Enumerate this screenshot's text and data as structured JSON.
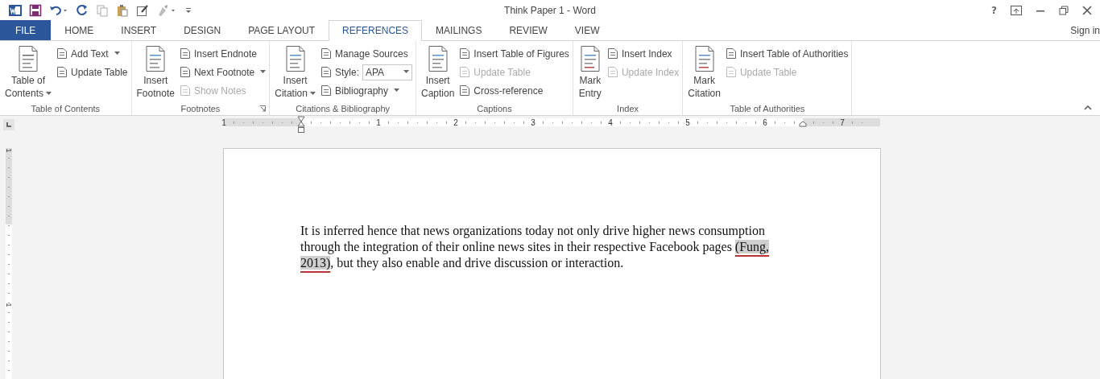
{
  "window": {
    "title": "Think Paper 1 - Word",
    "help": "?"
  },
  "tabs": [
    {
      "label": "FILE",
      "kind": "file",
      "selected": false
    },
    {
      "label": "HOME",
      "kind": "tab",
      "selected": false
    },
    {
      "label": "INSERT",
      "kind": "tab",
      "selected": false
    },
    {
      "label": "DESIGN",
      "kind": "tab",
      "selected": false
    },
    {
      "label": "PAGE LAYOUT",
      "kind": "tab",
      "selected": false
    },
    {
      "label": "REFERENCES",
      "kind": "tab",
      "selected": true
    },
    {
      "label": "MAILINGS",
      "kind": "tab",
      "selected": false
    },
    {
      "label": "REVIEW",
      "kind": "tab",
      "selected": false
    },
    {
      "label": "VIEW",
      "kind": "tab",
      "selected": false
    }
  ],
  "sign_in": "Sign in",
  "ribbon": [
    {
      "label": "Table of Contents",
      "launcher": false,
      "columns": [
        {
          "kind": "large",
          "lines": [
            "Table of",
            "Contents"
          ],
          "dropdown": true,
          "disabled": false
        },
        {
          "kind": "stack",
          "items": [
            {
              "label": "Add Text",
              "dropdown": true,
              "disabled": false
            },
            {
              "label": "Update Table",
              "dropdown": false,
              "disabled": false
            }
          ]
        }
      ]
    },
    {
      "label": "Footnotes",
      "launcher": true,
      "columns": [
        {
          "kind": "large",
          "lines": [
            "Insert",
            "Footnote"
          ],
          "dropdown": false,
          "disabled": false
        },
        {
          "kind": "stack",
          "items": [
            {
              "label": "Insert Endnote",
              "dropdown": false,
              "disabled": false
            },
            {
              "label": "Next Footnote",
              "dropdown": true,
              "disabled": false
            },
            {
              "label": "Show Notes",
              "dropdown": false,
              "disabled": true
            }
          ]
        }
      ]
    },
    {
      "label": "Citations & Bibliography",
      "launcher": false,
      "columns": [
        {
          "kind": "large",
          "lines": [
            "Insert",
            "Citation"
          ],
          "dropdown": true,
          "disabled": false
        },
        {
          "kind": "stack",
          "items": [
            {
              "label": "Manage Sources",
              "dropdown": false,
              "disabled": false
            },
            {
              "label": "Style:",
              "dropdown": false,
              "disabled": false,
              "combo": "APA"
            },
            {
              "label": "Bibliography",
              "dropdown": true,
              "disabled": false
            }
          ]
        }
      ]
    },
    {
      "label": "Captions",
      "launcher": false,
      "columns": [
        {
          "kind": "large",
          "lines": [
            "Insert",
            "Caption"
          ],
          "dropdown": false,
          "disabled": false
        },
        {
          "kind": "stack",
          "items": [
            {
              "label": "Insert Table of Figures",
              "dropdown": false,
              "disabled": false
            },
            {
              "label": "Update Table",
              "dropdown": false,
              "disabled": true
            },
            {
              "label": "Cross-reference",
              "dropdown": false,
              "disabled": false
            }
          ]
        }
      ]
    },
    {
      "label": "Index",
      "launcher": false,
      "columns": [
        {
          "kind": "large",
          "lines": [
            "Mark",
            "Entry"
          ],
          "dropdown": false,
          "disabled": false
        },
        {
          "kind": "stack",
          "items": [
            {
              "label": "Insert Index",
              "dropdown": false,
              "disabled": false
            },
            {
              "label": "Update Index",
              "dropdown": false,
              "disabled": true
            }
          ]
        }
      ]
    },
    {
      "label": "Table of Authorities",
      "launcher": false,
      "columns": [
        {
          "kind": "large",
          "lines": [
            "Mark",
            "Citation"
          ],
          "dropdown": false,
          "disabled": false
        },
        {
          "kind": "stack",
          "items": [
            {
              "label": "Insert Table of Authorities",
              "dropdown": false,
              "disabled": false
            },
            {
              "label": "Update Table",
              "dropdown": false,
              "disabled": true
            }
          ]
        }
      ]
    }
  ],
  "ruler": {
    "marks": [
      "1",
      "1",
      "2",
      "3",
      "4",
      "5",
      "6",
      "7"
    ]
  },
  "vertical_ruler": {
    "marks": [
      "1",
      "1"
    ]
  },
  "document": {
    "paragraph": {
      "before": "It is inferred hence that news organizations today not only drive higher news consumption through the integration of their online news sites in their respective Facebook pages ",
      "citation": "(Fung, 2013)",
      "after": ", but they also enable and drive discussion or interaction."
    }
  }
}
